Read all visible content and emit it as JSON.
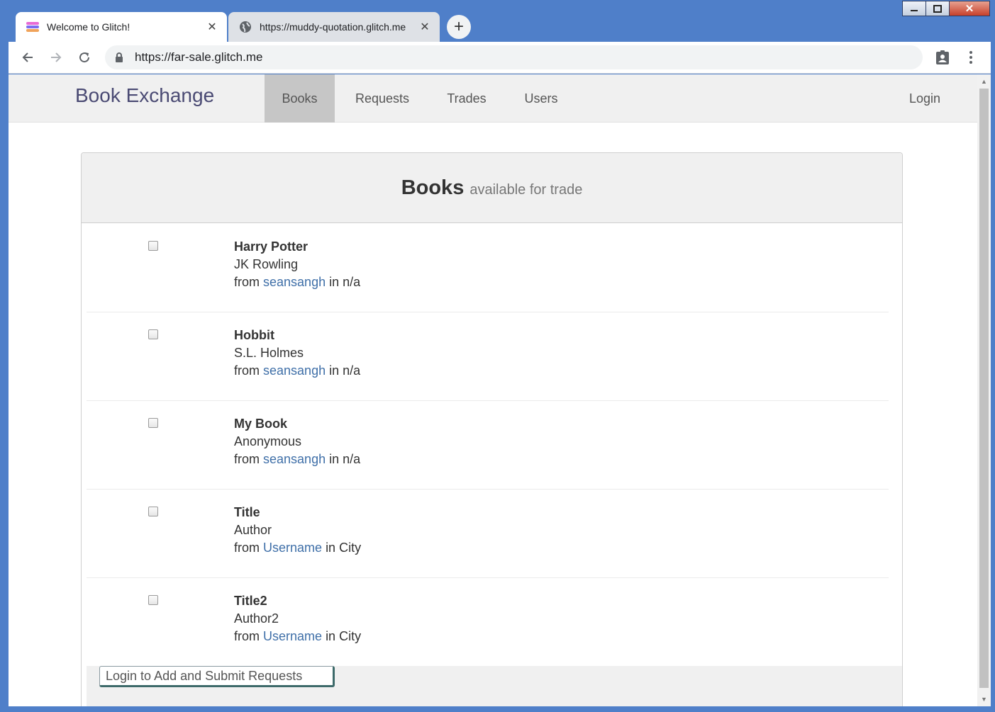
{
  "browser": {
    "tabs": [
      {
        "title": "Welcome to Glitch!",
        "active": true,
        "icon": "glitch-logo-icon"
      },
      {
        "title": "https://muddy-quotation.glitch.me",
        "active": false,
        "icon": "globe-icon"
      }
    ],
    "new_tab_label": "+",
    "close_glyph": "✕",
    "url": "https://far-sale.glitch.me",
    "window_close_glyph": "✕"
  },
  "site": {
    "brand": "Book Exchange",
    "nav": [
      {
        "label": "Books",
        "active": true
      },
      {
        "label": "Requests",
        "active": false
      },
      {
        "label": "Trades",
        "active": false
      },
      {
        "label": "Users",
        "active": false
      }
    ],
    "login_label": "Login"
  },
  "panel": {
    "heading": "Books",
    "subheading": "available for trade",
    "from_label": "from",
    "in_label": "in",
    "books": [
      {
        "title": "Harry Potter",
        "author": "JK Rowling",
        "owner": "seansangh",
        "location": "n/a",
        "checked": false
      },
      {
        "title": "Hobbit",
        "author": "S.L. Holmes",
        "owner": "seansangh",
        "location": "n/a",
        "checked": false
      },
      {
        "title": "My Book",
        "author": "Anonymous",
        "owner": "seansangh",
        "location": "n/a",
        "checked": false
      },
      {
        "title": "Title",
        "author": "Author",
        "owner": "Username",
        "location": "City",
        "checked": false
      },
      {
        "title": "Title2",
        "author": "Author2",
        "owner": "Username",
        "location": "City",
        "checked": false
      }
    ],
    "submit_label": "Login to Add and Submit Requests"
  },
  "colors": {
    "brand": "#4a4a73",
    "link": "#3f6fa8",
    "nav_active_bg": "#c6c6c6"
  }
}
